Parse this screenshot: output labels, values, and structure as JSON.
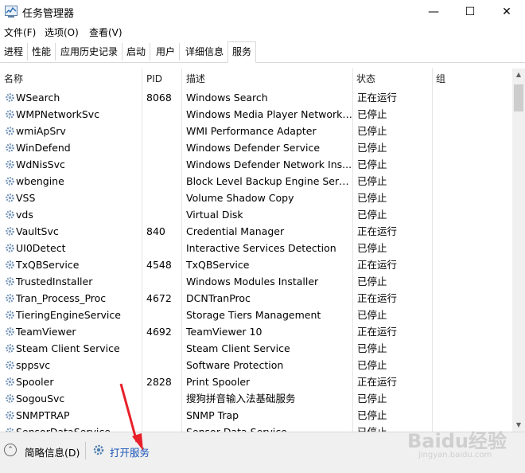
{
  "window": {
    "title": "任务管理器",
    "minimize": "—",
    "maximize": "☐",
    "close": "✕"
  },
  "menu": [
    "文件(F)",
    "选项(O)",
    "查看(V)"
  ],
  "tabs": [
    "进程",
    "性能",
    "应用历史记录",
    "启动",
    "用户",
    "详细信息",
    "服务"
  ],
  "active_tab": "服务",
  "columns": {
    "name": "名称",
    "pid": "PID",
    "desc": "描述",
    "status": "状态",
    "group": "组"
  },
  "rows": [
    {
      "name": "WSearch",
      "pid": "8068",
      "desc": "Windows Search",
      "status": "正在运行"
    },
    {
      "name": "WMPNetworkSvc",
      "pid": "",
      "desc": "Windows Media Player Network ...",
      "status": "已停止"
    },
    {
      "name": "wmiApSrv",
      "pid": "",
      "desc": "WMI Performance Adapter",
      "status": "已停止"
    },
    {
      "name": "WinDefend",
      "pid": "",
      "desc": "Windows Defender Service",
      "status": "已停止"
    },
    {
      "name": "WdNisSvc",
      "pid": "",
      "desc": "Windows Defender Network Ins...",
      "status": "已停止"
    },
    {
      "name": "wbengine",
      "pid": "",
      "desc": "Block Level Backup Engine Service",
      "status": "已停止"
    },
    {
      "name": "VSS",
      "pid": "",
      "desc": "Volume Shadow Copy",
      "status": "已停止"
    },
    {
      "name": "vds",
      "pid": "",
      "desc": "Virtual Disk",
      "status": "已停止"
    },
    {
      "name": "VaultSvc",
      "pid": "840",
      "desc": "Credential Manager",
      "status": "正在运行"
    },
    {
      "name": "UI0Detect",
      "pid": "",
      "desc": "Interactive Services Detection",
      "status": "已停止"
    },
    {
      "name": "TxQBService",
      "pid": "4548",
      "desc": "TxQBService",
      "status": "正在运行"
    },
    {
      "name": "TrustedInstaller",
      "pid": "",
      "desc": "Windows Modules Installer",
      "status": "已停止"
    },
    {
      "name": "Tran_Process_Proc",
      "pid": "4672",
      "desc": "DCNTranProc",
      "status": "正在运行"
    },
    {
      "name": "TieringEngineService",
      "pid": "",
      "desc": "Storage Tiers Management",
      "status": "已停止"
    },
    {
      "name": "TeamViewer",
      "pid": "4692",
      "desc": "TeamViewer 10",
      "status": "正在运行"
    },
    {
      "name": "Steam Client Service",
      "pid": "",
      "desc": "Steam Client Service",
      "status": "已停止"
    },
    {
      "name": "sppsvc",
      "pid": "",
      "desc": "Software Protection",
      "status": "已停止"
    },
    {
      "name": "Spooler",
      "pid": "2828",
      "desc": "Print Spooler",
      "status": "正在运行"
    },
    {
      "name": "SogouSvc",
      "pid": "",
      "desc": "搜狗拼音输入法基础服务",
      "status": "已停止"
    },
    {
      "name": "SNMPTRAP",
      "pid": "",
      "desc": "SNMP Trap",
      "status": "已停止"
    },
    {
      "name": "SensorDataService",
      "pid": "",
      "desc": "Sensor Data Service",
      "status": "已停止"
    }
  ],
  "footer": {
    "collapse_label": "简略信息(D)",
    "open_services": "打开服务"
  },
  "watermark": {
    "text": "Baidu经验",
    "url": "jingyan.baidu.com"
  },
  "colors": {
    "link": "#1a56b8",
    "annotation_arrow": "#e8202a"
  },
  "icons": {
    "app": "task-manager-icon",
    "service": "gear-icon",
    "collapse": "chevron-up-circle-icon",
    "open": "gear-icon"
  }
}
